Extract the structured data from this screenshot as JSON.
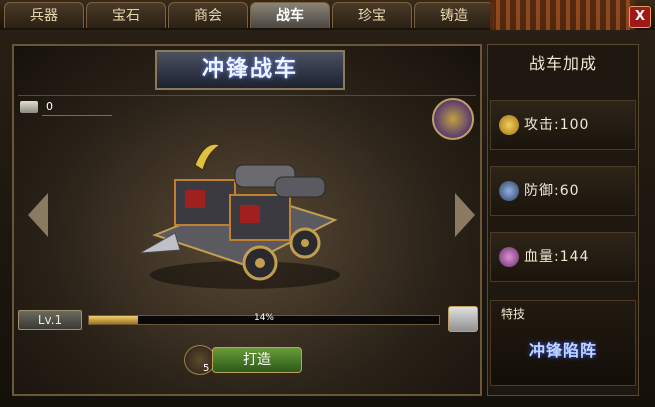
{
  "tabs": [
    {
      "label": "兵器",
      "active": false
    },
    {
      "label": "宝石",
      "active": false
    },
    {
      "label": "商会",
      "active": false
    },
    {
      "label": "战车",
      "active": true
    },
    {
      "label": "珍宝",
      "active": false
    },
    {
      "label": "铸造",
      "active": false
    }
  ],
  "close_label": "X",
  "panel": {
    "title": "冲锋战车",
    "resource_count": "0",
    "level": "Lv.1",
    "progress": 0.14,
    "progress_label": "14%",
    "forge_button": "打造",
    "forge_cost": "5"
  },
  "bonus": {
    "title": "战车加成",
    "attack": "攻击:100",
    "defense": "防御:60",
    "hp": "血量:144"
  },
  "skill": {
    "label": "特技",
    "name": "冲锋陷阵"
  },
  "icons": {
    "attack": "sword-icon",
    "defense": "shield-icon",
    "hp": "blood-icon",
    "resource": "ingot-icon"
  },
  "colors": {
    "attack": "#e0b020",
    "defense": "#5070a0",
    "hp": "#b050a0"
  }
}
